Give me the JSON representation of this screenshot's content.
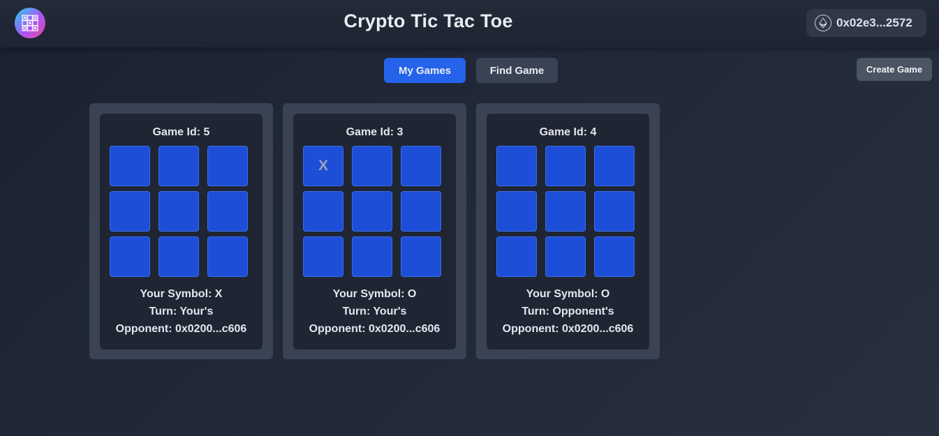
{
  "header": {
    "title": "Crypto Tic Tac Toe",
    "logo_icon": "tic-tac-toe-logo-icon",
    "wallet": {
      "icon": "ethereum-icon",
      "address": "0x02e3...2572"
    }
  },
  "tabs": [
    {
      "label": "My Games",
      "active": true
    },
    {
      "label": "Find Game",
      "active": false
    }
  ],
  "create_game_label": "Create Game",
  "games": [
    {
      "game_id_text": "Game Id: 5",
      "board": [
        "",
        "",
        "",
        "",
        "",
        "",
        "",
        "",
        ""
      ],
      "symbol_text": "Your Symbol: X",
      "turn_text": "Turn: Your's",
      "opponent_text": "Opponent: 0x0200...c606"
    },
    {
      "game_id_text": "Game Id: 3",
      "board": [
        "X",
        "",
        "",
        "",
        "",
        "",
        "",
        "",
        ""
      ],
      "symbol_text": "Your Symbol: O",
      "turn_text": "Turn: Your's",
      "opponent_text": "Opponent: 0x0200...c606"
    },
    {
      "game_id_text": "Game Id: 4",
      "board": [
        "",
        "",
        "",
        "",
        "",
        "",
        "",
        "",
        ""
      ],
      "symbol_text": "Your Symbol: O",
      "turn_text": "Turn: Opponent's",
      "opponent_text": "Opponent: 0x0200...c606"
    }
  ],
  "colors": {
    "accent": "#2563eb",
    "cell": "#1d4ed8",
    "background": "#222a3a"
  }
}
